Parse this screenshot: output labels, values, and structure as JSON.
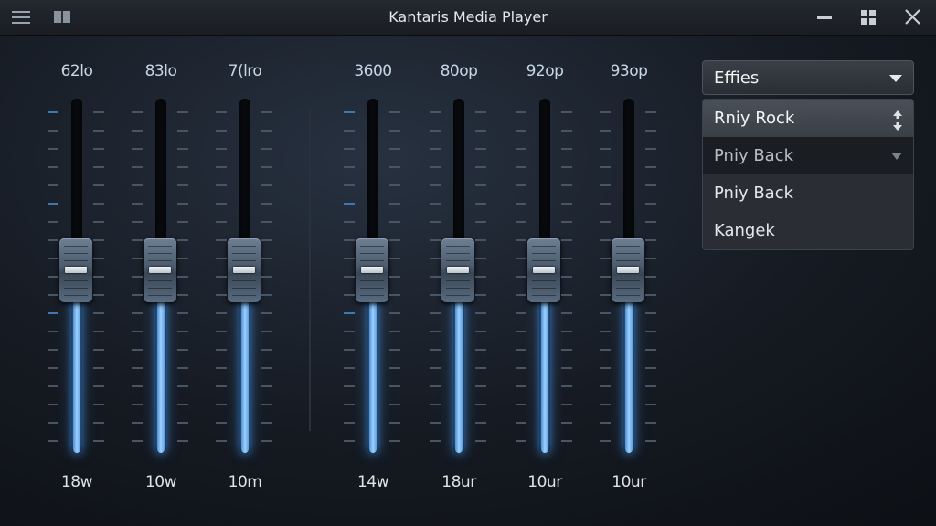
{
  "window": {
    "title": "Kantaris Media Player"
  },
  "titlebar": {
    "left_icons": [
      "menu-icon",
      "library-icon"
    ],
    "right_icons": [
      "minimize-icon",
      "layout-icon",
      "close-icon"
    ]
  },
  "equalizer": {
    "bands": [
      {
        "value": "62lo",
        "freq": "18w",
        "level": 0.5
      },
      {
        "value": "83lo",
        "freq": "10w",
        "level": 0.5
      },
      {
        "value": "7(lro",
        "freq": "10m",
        "level": 0.5
      },
      {
        "value": "3600",
        "freq": "14w",
        "level": 0.5
      },
      {
        "value": "80op",
        "freq": "18ur",
        "level": 0.5
      },
      {
        "value": "92op",
        "freq": "10ur",
        "level": 0.5
      },
      {
        "value": "93op",
        "freq": "10ur",
        "level": 0.5
      }
    ]
  },
  "preset": {
    "label": "Effies",
    "options": [
      "Rniy Rock",
      "Pniy Back",
      "Pniy Back",
      "Kangek"
    ],
    "selected_index": 0
  },
  "colors": {
    "accent": "#4f9be6",
    "background": "#161b23"
  }
}
